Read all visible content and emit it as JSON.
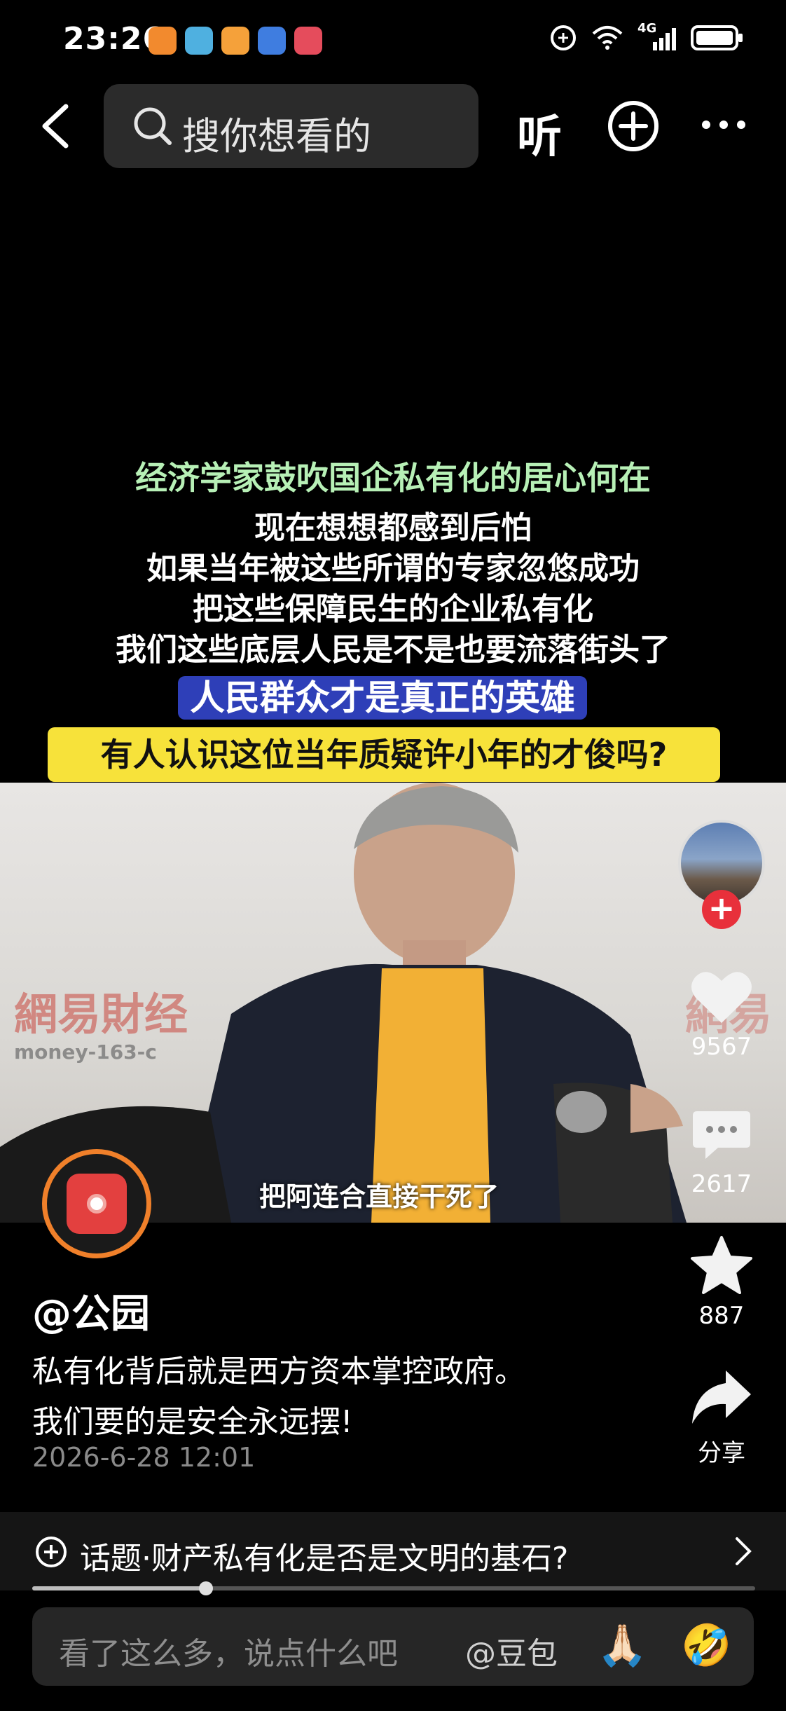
{
  "status_bar": {
    "time": "23:26",
    "network": "4G",
    "app_icon_colors": [
      "#f28a2e",
      "#4fb0e0",
      "#f5a13a",
      "#3f7de0",
      "#e54c5c"
    ]
  },
  "top_bar": {
    "search_placeholder": "搜你想看的",
    "listen_label": "听"
  },
  "video": {
    "captions": [
      "经济学家鼓吹国企私有化的居心何在",
      "现在想想都感到后怕",
      "如果当年被这些所谓的专家忽悠成功",
      "把这些保障民生的企业私有化",
      "我们这些底层人民是不是也要流落街头了",
      "人民群众才是真正的英雄",
      "有人认识这位当年质疑许小年的才俊吗?"
    ],
    "watermark": "網易財经",
    "watermark_url": "money-163-c",
    "watermark_right": "網易",
    "subtitle": "把阿连合直接干死了"
  },
  "actions": {
    "likes": "9567",
    "comments": "2617",
    "favorites": "887",
    "share_label": "分享"
  },
  "post": {
    "author": "@公园",
    "description_lines": [
      "私有化背后就是西方资本掌控政府。",
      "我们要的是安全永远摆!"
    ],
    "date": "2026-6-28 12:01"
  },
  "topic": {
    "label": "话题·财产私有化是否是文明的基石?"
  },
  "playback": {
    "progress_fraction": 0.24
  },
  "comment_bar": {
    "placeholder": "看了这么多，说点什么吧",
    "mention": "@豆包",
    "emoji_1": "🙏🏻",
    "emoji_2": "🤣"
  },
  "colors": {
    "accent_red": "#e8303b",
    "caption_green": "#b7f0b6",
    "caption_yellow_bg": "#f7e23a",
    "caption_blue_bg": "#2e3fb8",
    "disc_ring": "#f0802a"
  }
}
